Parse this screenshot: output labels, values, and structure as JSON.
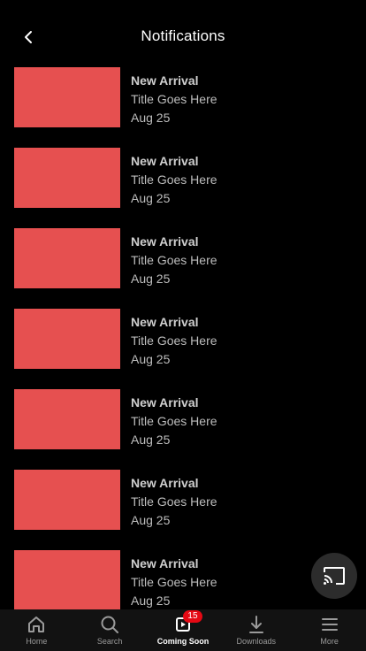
{
  "header": {
    "title": "Notifications"
  },
  "notifications": [
    {
      "type": "New Arrival",
      "title": "Title Goes Here",
      "date": "Aug 25"
    },
    {
      "type": "New Arrival",
      "title": "Title Goes Here",
      "date": "Aug 25"
    },
    {
      "type": "New Arrival",
      "title": "Title Goes Here",
      "date": "Aug 25"
    },
    {
      "type": "New Arrival",
      "title": "Title Goes Here",
      "date": "Aug 25"
    },
    {
      "type": "New Arrival",
      "title": "Title Goes Here",
      "date": "Aug 25"
    },
    {
      "type": "New Arrival",
      "title": "Title Goes Here",
      "date": "Aug 25"
    },
    {
      "type": "New Arrival",
      "title": "Title Goes Here",
      "date": "Aug 25"
    }
  ],
  "tabs": [
    {
      "label": "Home",
      "icon": "home-icon"
    },
    {
      "label": "Search",
      "icon": "search-icon"
    },
    {
      "label": "Coming Soon",
      "icon": "coming-soon-icon",
      "badge": "15",
      "active": true
    },
    {
      "label": "Downloads",
      "icon": "download-icon"
    },
    {
      "label": "More",
      "icon": "menu-icon"
    }
  ],
  "colors": {
    "background": "#000000",
    "thumbnail": "#e65050",
    "badge": "#e50914",
    "tabbar": "#121212"
  },
  "cast": {
    "icon": "cast-icon"
  }
}
